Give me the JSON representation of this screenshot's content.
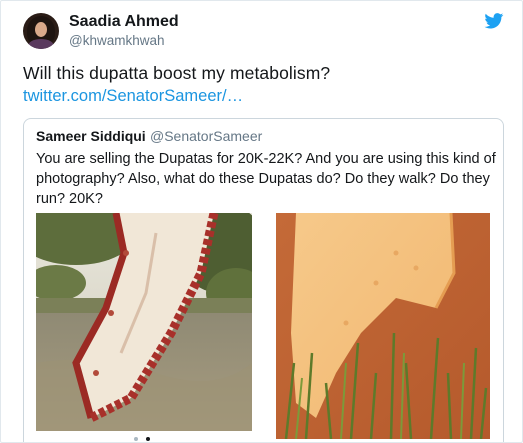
{
  "tweet": {
    "author_name": "Saadia Ahmed",
    "author_handle": "@khwamkhwah",
    "text": "Will this dupatta boost my metabolism?",
    "link_text": "twitter.com/SenatorSameer/…"
  },
  "quoted_tweet": {
    "author_name": "Sameer Siddiqui",
    "author_handle": "@SenatorSameer",
    "text": "You are selling the Dupatas for 20K-22K? And you are using this kind of photography? Also, what do these Dupatas do? Do they walk? Do they run? 20K?"
  },
  "media": [
    {
      "name": "dupatta-outdoor-photo",
      "description_icon": "photo-icon"
    },
    {
      "name": "dupatta-orange-photo",
      "description_icon": "photo-icon"
    }
  ],
  "carousel": {
    "count": 2,
    "active_index": 1
  },
  "colors": {
    "link": "#1b95e0",
    "twitter_blue": "#1da1f2",
    "text": "#14171a",
    "muted": "#657786",
    "border": "#e1e8ed"
  },
  "icons": {
    "brand": "twitter-bird-icon"
  }
}
